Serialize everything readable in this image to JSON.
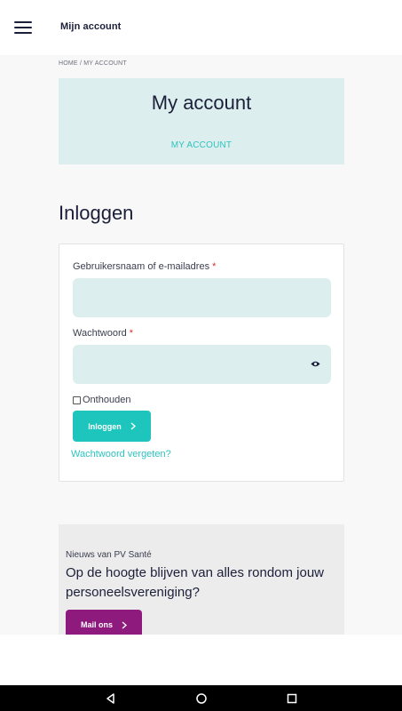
{
  "topbar": {
    "title": "Mijn account",
    "menu_icon": "hamburger-menu-icon"
  },
  "breadcrumb": {
    "home": "HOME",
    "separator": "/",
    "current": "MY ACCOUNT"
  },
  "hero": {
    "title": "My account",
    "subtitle": "MY ACCOUNT"
  },
  "login": {
    "heading": "Inloggen",
    "username_label": "Gebruikersnaam of e-mailadres",
    "username_value": "",
    "password_label": "Wachtwoord",
    "password_value": "",
    "required_mark": "*",
    "password_toggle_icon": "eye-icon",
    "remember_label": "Onthouden",
    "remember_checked": false,
    "submit_label": "Inloggen",
    "forgot_label": "Wachtwoord vergeten?"
  },
  "newsletter": {
    "small_label": "Nieuws van PV Santé",
    "title": "Op de hoogte blijven van alles rondom jouw personeelsvereniging?",
    "button_label": "Mail ons"
  },
  "colors": {
    "accent": "#1ec5bc",
    "accent_text": "#2ec3bf",
    "field_bg": "#dcefee",
    "mail_button": "#8e1a7e",
    "required": "#d32f2f"
  },
  "system_nav": {
    "back_icon": "back-triangle-icon",
    "home_icon": "home-circle-icon",
    "recents_icon": "recents-square-icon"
  }
}
